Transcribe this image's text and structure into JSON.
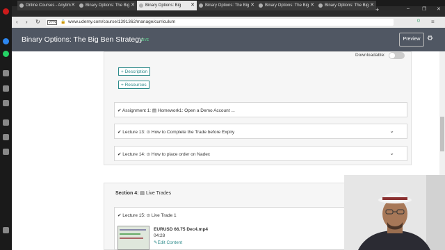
{
  "browser": {
    "tabs": [
      {
        "label": "Online Courses - Anytim",
        "active": false
      },
      {
        "label": "Binary Options: The Big",
        "active": false
      },
      {
        "label": "Binary Options: Big",
        "active": true
      },
      {
        "label": "Binary Options: The Big",
        "active": false
      },
      {
        "label": "Binary Options: The Big",
        "active": false
      },
      {
        "label": "Binary Options: The Big",
        "active": false
      }
    ],
    "new_tab": "+",
    "window_controls": {
      "minimize": "–",
      "restore": "❐",
      "close": "✕"
    },
    "vpn_label": "VPN",
    "url": "www.udemy.com/course/1391362/manage/curriculum",
    "extension_badge": "0"
  },
  "header": {
    "course_title": "Binary Options: The Big Ben Strategy",
    "status": "LIVE",
    "preview_label": "Preview"
  },
  "section3": {
    "downloadable_label": "Downloadable:",
    "description_button": "Description",
    "resources_button": "Resources",
    "items": [
      {
        "prefix": "Assignment 1:",
        "title": "Homework1: Open a Demo Account ...",
        "expandable": false
      },
      {
        "prefix": "Lecture 13:",
        "title": "How to Complete the Trade before Expiry",
        "expandable": true
      },
      {
        "prefix": "Lecture 14:",
        "title": "How to place order on Nadex",
        "expandable": true
      }
    ]
  },
  "section4": {
    "label": "Section 4:",
    "title": "Live Trades",
    "lecture": {
      "prefix": "Lecture 15:",
      "title": "Live Trade 1"
    },
    "video": {
      "filename": "EURUSD 66.75 Dec4.mp4",
      "duration": "04:28",
      "edit_label": "Edit Content"
    }
  },
  "icons": {
    "check": "check-circle",
    "document": "document",
    "play": "play-circle"
  },
  "colors": {
    "header_bg": "#505763",
    "accent": "#2c8a8a",
    "live": "#5fbf8a"
  }
}
